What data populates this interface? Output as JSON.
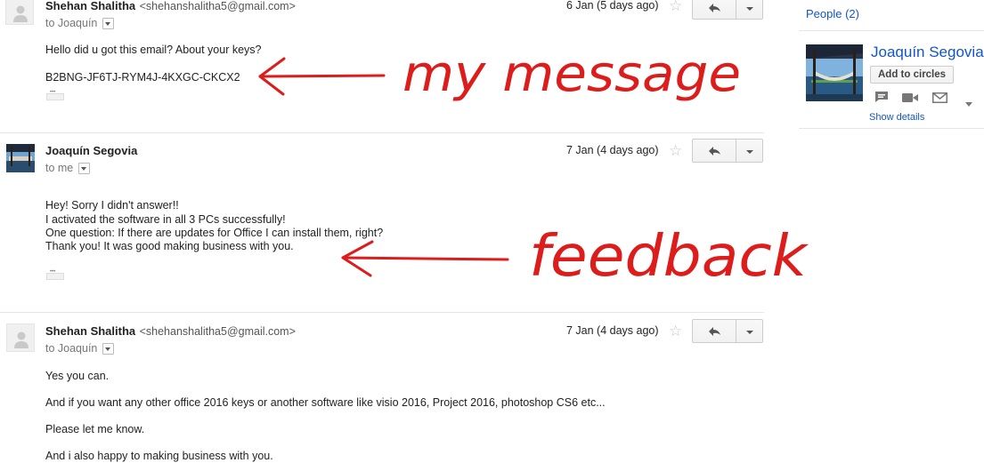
{
  "messages": [
    {
      "sender_name": "Shehan Shalitha",
      "sender_email": "<shehanshalitha5@gmail.com>",
      "to": "to Joaquín",
      "date": "6 Jan (5 days ago)",
      "lines": [
        "Hello did u got this email? About your keys?",
        "B2BNG-JF6TJ-RYM4J-4KXGC-CKCX2"
      ]
    },
    {
      "sender_name": "Joaquín Segovia",
      "sender_email": "",
      "to": "to me",
      "date": "7 Jan (4 days ago)",
      "lines": [
        "Hey! Sorry I didn't answer!!",
        "I activated the software in all 3 PCs successfully!",
        "One question: If there are updates for Office I can install them, right?",
        "Thank you! It was good making business with you."
      ]
    },
    {
      "sender_name": "Shehan Shalitha",
      "sender_email": "<shehanshalitha5@gmail.com>",
      "to": "to Joaquín",
      "date": "7 Jan (4 days ago)",
      "lines": [
        "Yes you can.",
        "And if you want any other office 2016 keys or another software like visio 2016, Project 2016, photoshop CS6 etc...",
        "Please let me know.",
        "And i also happy to making business with you."
      ]
    }
  ],
  "sidebar": {
    "people_label": "People (2)",
    "contact_name": "Joaquín Segovia",
    "add_circles_label": "Add to circles",
    "show_details_label": "Show details"
  },
  "annotations": {
    "first": "my message",
    "second": "feedback"
  },
  "colors": {
    "annotation": "#dd1c1c",
    "link": "#1155cc"
  },
  "icons": [
    "reply-icon",
    "star-icon",
    "chevron-down-icon",
    "chat-icon",
    "video-icon",
    "mail-icon",
    "person-silhouette-icon"
  ]
}
